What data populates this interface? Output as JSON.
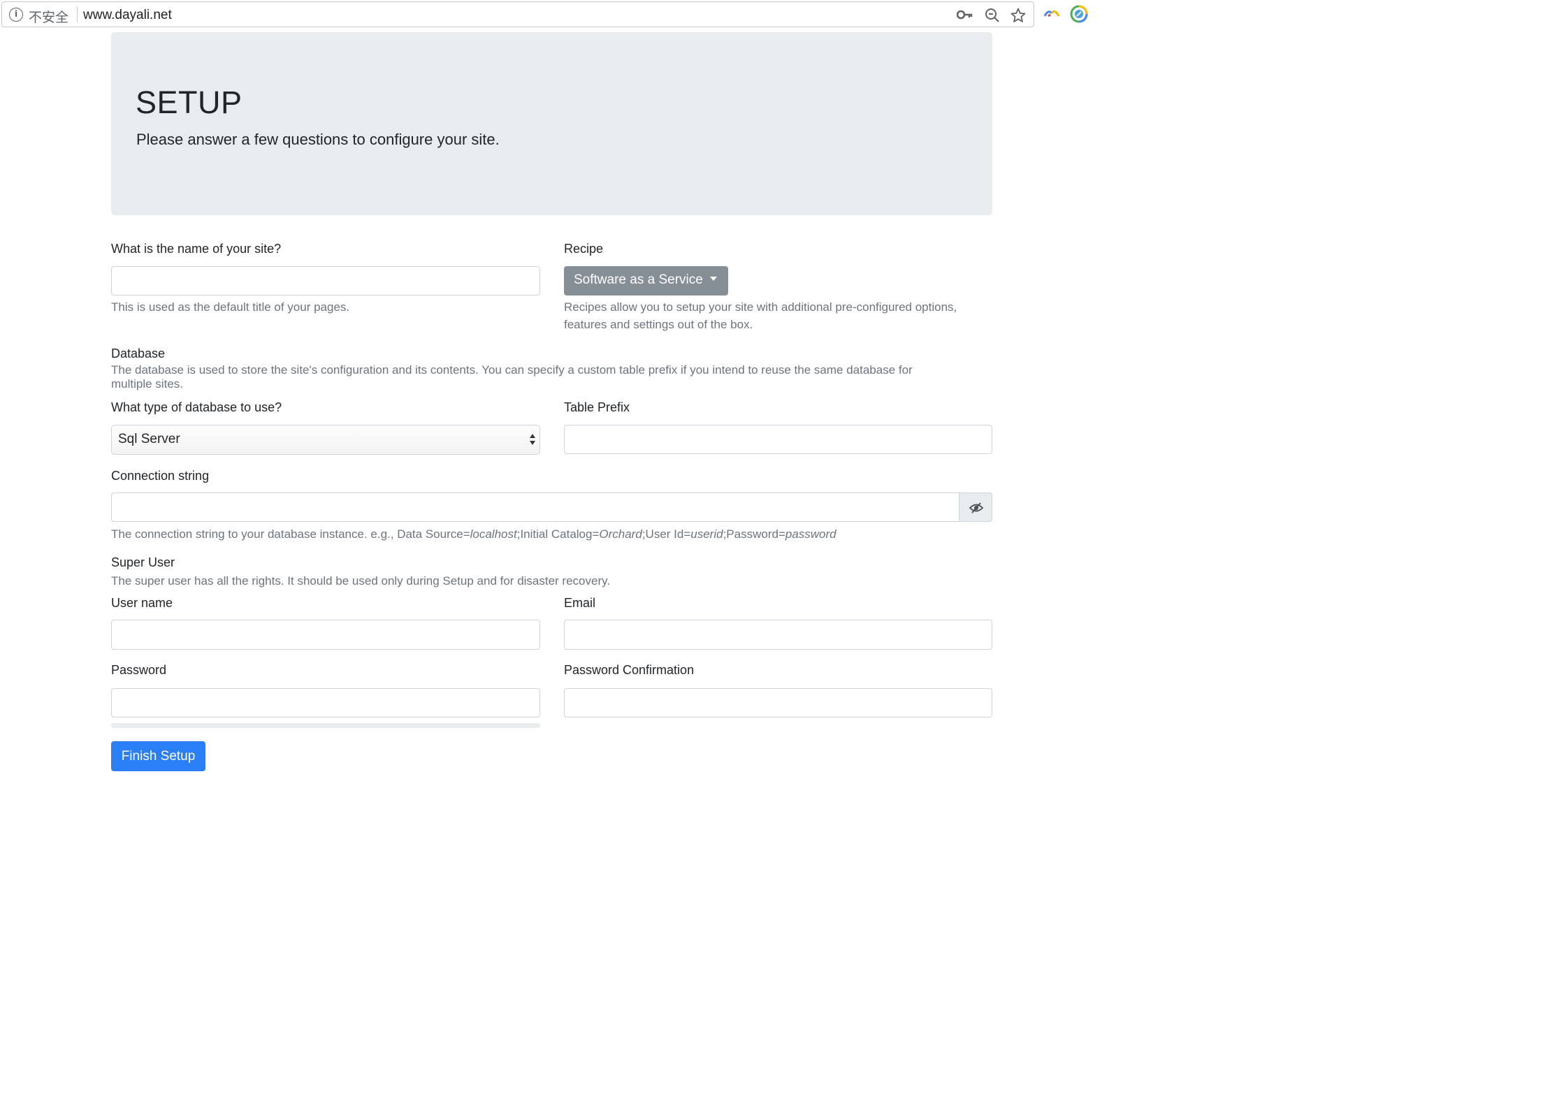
{
  "browser": {
    "security_label": "不安全",
    "url": "www.dayali.net"
  },
  "jumbotron": {
    "title": "SETUP",
    "lead": "Please answer a few questions to configure your site."
  },
  "site_name": {
    "label": "What is the name of your site?",
    "value": "",
    "help": "This is used as the default title of your pages."
  },
  "recipe": {
    "label": "Recipe",
    "selected": "Software as a Service",
    "help_line1": "Recipes allow you to setup your site with additional pre-configured options,",
    "help_line2": "features and settings out of the box."
  },
  "database": {
    "title": "Database",
    "help_line1": "The database is used to store the site's configuration and its contents. You can specify a custom table prefix if you intend to reuse the same database for",
    "help_line2": "multiple sites.",
    "type_label": "What type of database to use?",
    "type_selected": "Sql Server",
    "prefix_label": "Table Prefix",
    "prefix_value": "",
    "connection_label": "Connection string",
    "connection_value": "",
    "connection_help": {
      "intro": "The connection string to your database instance. e.g., Data Source=",
      "source": "localhost",
      "catalog_key": ";Initial Catalog=",
      "catalog": "Orchard",
      "user_key": ";User Id=",
      "user": "userid",
      "password_key": ";Password=",
      "password": "password"
    }
  },
  "super_user": {
    "title": "Super User",
    "help": "The super user has all the rights. It should be used only during Setup and for disaster recovery.",
    "username_label": "User name",
    "email_label": "Email",
    "password_label": "Password",
    "password_confirm_label": "Password Confirmation"
  },
  "actions": {
    "finish": "Finish Setup"
  },
  "colors": {
    "primary": "#2a7ff6",
    "secondary": "#868e96",
    "jumbotron_bg": "#e9ecef",
    "help_text": "#6c757d"
  },
  "icons": [
    "info-icon",
    "key-icon",
    "zoom-icon",
    "star-icon",
    "extension-icon",
    "chrome-extension-icon",
    "eye-slash-icon",
    "caret-down-icon",
    "select-arrows-icon"
  ]
}
